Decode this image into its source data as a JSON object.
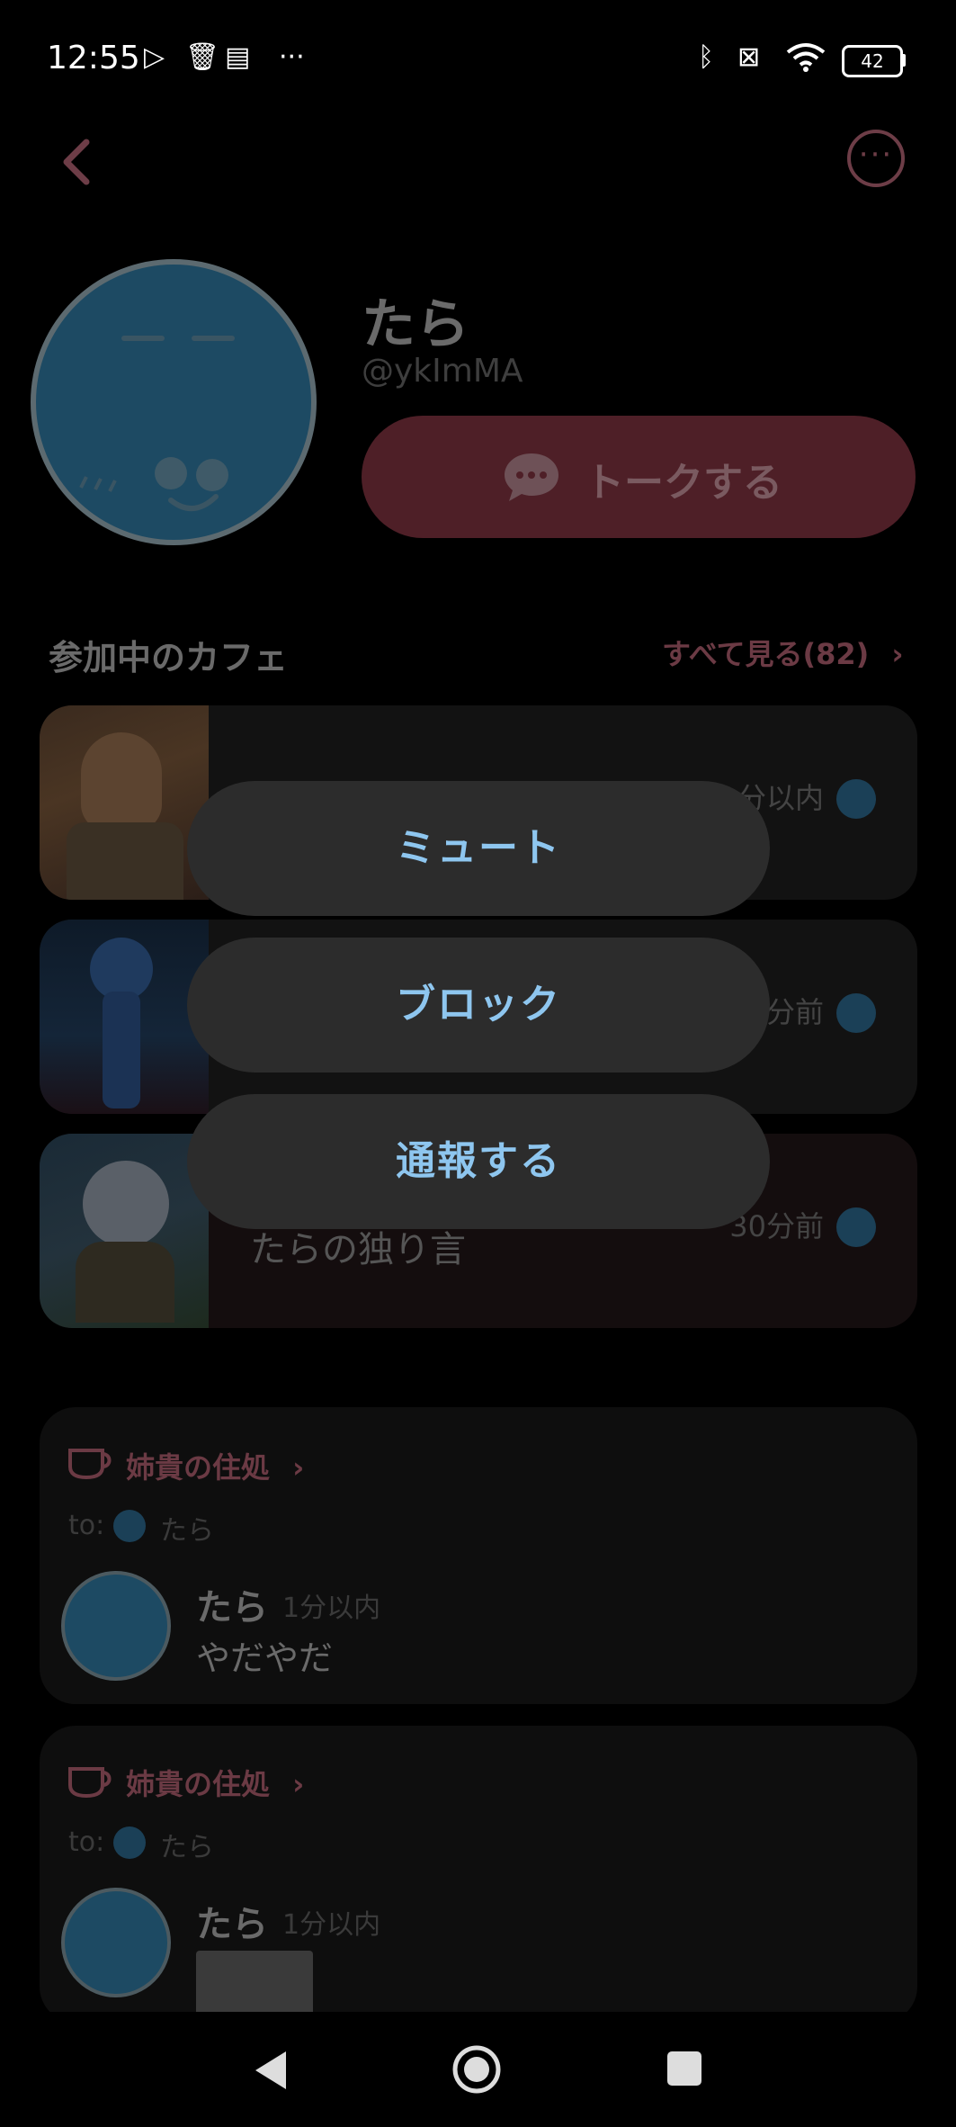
{
  "status_bar": {
    "time": "12:55",
    "battery": "42",
    "more": "···"
  },
  "header": {
    "back_icon": "chevron-left-icon",
    "more_icon": "more-horizontal-icon"
  },
  "profile": {
    "name": "たら",
    "handle": "@ykImMA",
    "talk_button": "トークする"
  },
  "cafes": {
    "title": "参加中のカフェ",
    "see_all": "すべて見る(82)",
    "items": [
      {
        "time": "1分以内",
        "title": ""
      },
      {
        "time": "1分前",
        "title": ""
      },
      {
        "time": "30分前",
        "title": "たらの独り言"
      }
    ]
  },
  "popup_menu": {
    "items": [
      "ミュート",
      "ブロック",
      "通報する"
    ]
  },
  "posts": [
    {
      "cafe": "姉貴の住処",
      "to_label": "to:",
      "to_name": "たら",
      "author": "たら",
      "time": "1分以内",
      "body": "やだやだ"
    },
    {
      "cafe": "姉貴の住処",
      "to_label": "to:",
      "to_name": "たら",
      "author": "たら",
      "time": "1分以内",
      "body": ""
    }
  ],
  "colors": {
    "accent_dim": "#6b3a44",
    "menu_text": "#8ec6ef",
    "menu_bg": "#2c2c2c",
    "overlay_bg": "#000000"
  }
}
